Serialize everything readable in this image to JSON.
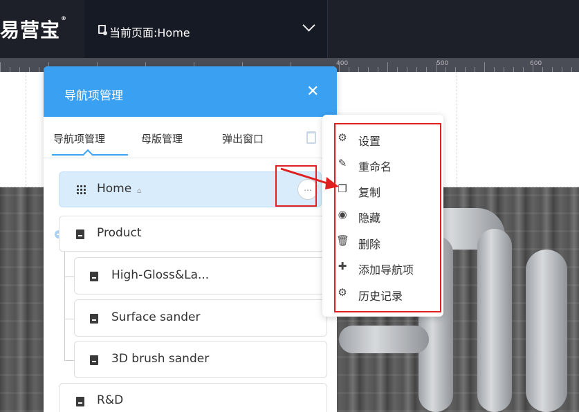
{
  "topbar": {
    "brand": "易营宝",
    "brand_mark": "®",
    "page_selector_label": "当前页面:Home"
  },
  "ruler": {
    "labels": [
      "400",
      "500",
      "600"
    ]
  },
  "panel": {
    "title": "导航项管理",
    "close_glyph": "✕",
    "tabs": [
      {
        "label": "导航项管理"
      },
      {
        "label": "母版管理"
      },
      {
        "label": "弹出窗口"
      }
    ],
    "items": [
      {
        "label": "Home",
        "level": 0,
        "selected": true
      },
      {
        "label": "Product",
        "level": 0
      },
      {
        "label": "High-Gloss&La...",
        "level": 1
      },
      {
        "label": "Surface sander",
        "level": 1
      },
      {
        "label": "3D brush sander",
        "level": 1
      },
      {
        "label": "R&D",
        "level": 0
      }
    ],
    "more_glyph": "..."
  },
  "context_menu": {
    "items": [
      {
        "label": "设置",
        "icon": "gear-icon",
        "glyph": "⚙"
      },
      {
        "label": "重命名",
        "icon": "rename-icon",
        "glyph": "✎"
      },
      {
        "label": "复制",
        "icon": "copy-icon",
        "glyph": "❐"
      },
      {
        "label": "隐藏",
        "icon": "eye-icon",
        "glyph": "◉"
      },
      {
        "label": "删除",
        "icon": "trash-icon",
        "glyph": "🗑"
      },
      {
        "label": "添加导航项",
        "icon": "plus-icon",
        "glyph": "✚"
      },
      {
        "label": "历史记录",
        "icon": "history-icon",
        "glyph": "⚙"
      }
    ]
  },
  "colors": {
    "accent": "#3aa0f2",
    "topbar": "#1d2029",
    "annotation": "#e02020",
    "selected_row": "#d9ecfb"
  }
}
